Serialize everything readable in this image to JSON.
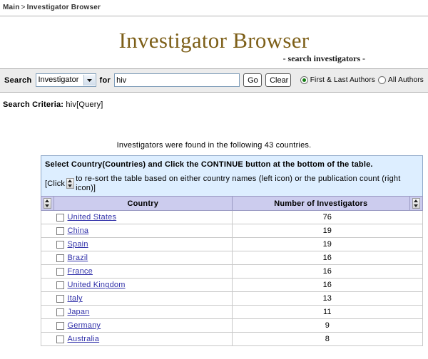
{
  "breadcrumb": {
    "root": "Main",
    "separator": ">",
    "current": "Investigator Browser"
  },
  "header": {
    "title": "Investigator Browser",
    "subtitle": "- search investigators -",
    "title_color": "#7d5f18"
  },
  "search": {
    "search_label": "Search",
    "select_value": "Investigator",
    "select_options": [
      "Investigator"
    ],
    "for_label": "for",
    "query_value": "hiv",
    "query_placeholder": "",
    "go_label": "Go",
    "clear_label": "Clear",
    "radios": [
      {
        "label": "First & Last Authors",
        "checked": true
      },
      {
        "label": "All Authors",
        "checked": false
      }
    ],
    "radio_checked_color": "#127c12"
  },
  "criteria": {
    "label": "Search Criteria:",
    "value": "hiv[Query]"
  },
  "results": {
    "found_text": "Investigators were found in the following 43 countries.",
    "instructions_line1": "Select Country(Countries) and Click the CONTINUE button at the bottom of the table.",
    "instructions_line2_a": "[Click",
    "instructions_line2_b": "to re-sort the table based on either country names (left icon) or the publication count (right icon)]",
    "columns": {
      "country": "Country",
      "count": "Number of Investigators"
    },
    "rows": [
      {
        "country": "United States",
        "count": "76"
      },
      {
        "country": "China",
        "count": "19"
      },
      {
        "country": "Spain",
        "count": "19"
      },
      {
        "country": "Brazil",
        "count": "16"
      },
      {
        "country": "France",
        "count": "16"
      },
      {
        "country": "United Kingdom",
        "count": "16"
      },
      {
        "country": "Italy",
        "count": "13"
      },
      {
        "country": "Japan",
        "count": "11"
      },
      {
        "country": "Germany",
        "count": "9"
      },
      {
        "country": "Australia",
        "count": "8"
      }
    ]
  }
}
